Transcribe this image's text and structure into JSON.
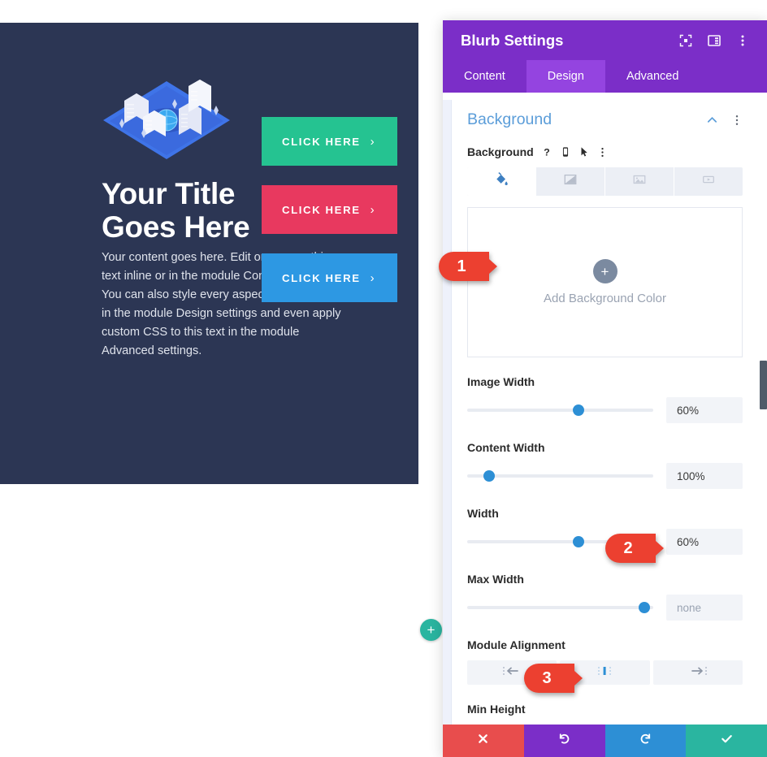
{
  "preview": {
    "hero": {
      "title": "Your Title\nGoes Here",
      "title_line1": "Your Title",
      "title_line2": "Goes Here",
      "body": "Your content goes here. Edit or remove this text inline or in the module Content settings. You can also style every aspect of this content in the module Design settings and even apply custom CSS to this text in the module Advanced settings.",
      "background_color": "#2c3654",
      "illustration": "isometric-city-illustration"
    },
    "buttons": [
      {
        "label": "CLICK HERE",
        "chevron": "›",
        "color": "#25c391",
        "name": "cta-button-green"
      },
      {
        "label": "CLICK HERE",
        "chevron": "›",
        "color": "#e8395f",
        "name": "cta-button-pink"
      },
      {
        "label": "CLICK HERE",
        "chevron": "›",
        "color": "#2d98e3",
        "name": "cta-button-blue"
      }
    ],
    "add_module": {
      "glyph": "+",
      "color": "#2ab5a0",
      "icon": "plus-icon"
    }
  },
  "panel": {
    "title": "Blurb Settings",
    "header_color": "#7b2ec8",
    "header_icons": [
      "fullscreen-icon",
      "layout-panel-icon",
      "more-vertical-icon"
    ],
    "tabs": [
      {
        "label": "Content",
        "active": false
      },
      {
        "label": "Design",
        "active": true
      },
      {
        "label": "Advanced",
        "active": false
      }
    ],
    "active_tab_color": "#9444e0",
    "section": {
      "title": "Background",
      "collapse_icon": "chevron-up-icon",
      "more_icon": "more-vertical-icon"
    },
    "background_field": {
      "label": "Background",
      "icons": [
        "help-icon",
        "mobile-icon",
        "cursor-hover-icon",
        "more-vertical-icon"
      ],
      "types": [
        {
          "name": "background-color-tab",
          "icon": "paint-bucket-icon",
          "active": true
        },
        {
          "name": "background-gradient-tab",
          "icon": "gradient-icon",
          "active": false
        },
        {
          "name": "background-image-tab",
          "icon": "image-icon",
          "active": false
        },
        {
          "name": "background-video-tab",
          "icon": "video-icon",
          "active": false
        }
      ],
      "dropzone": {
        "plus": "+",
        "label": "Add Background Color"
      }
    },
    "sliders": [
      {
        "name": "image-width",
        "label": "Image Width",
        "value": "60%",
        "percent": 60,
        "placeholder": false
      },
      {
        "name": "content-width",
        "label": "Content Width",
        "value": "100%",
        "percent": 12,
        "placeholder": false
      },
      {
        "name": "width",
        "label": "Width",
        "value": "60%",
        "percent": 60,
        "placeholder": false
      },
      {
        "name": "max-width",
        "label": "Max Width",
        "value": "none",
        "percent": 93,
        "placeholder": true
      }
    ],
    "module_alignment": {
      "label": "Module Alignment",
      "options": [
        {
          "name": "align-left",
          "icon": "align-left-icon",
          "active": false
        },
        {
          "name": "align-center",
          "icon": "align-center-icon",
          "active": true
        },
        {
          "name": "align-right",
          "icon": "align-right-icon",
          "active": false
        }
      ]
    },
    "min_height": {
      "label": "Min Height"
    },
    "actions": [
      {
        "name": "cancel-button",
        "icon": "close-icon",
        "color": "#e84d4d"
      },
      {
        "name": "undo-button",
        "icon": "undo-icon",
        "color": "#7b2ec8"
      },
      {
        "name": "redo-button",
        "icon": "redo-icon",
        "color": "#2d8fd5"
      },
      {
        "name": "save-button",
        "icon": "check-icon",
        "color": "#2ab5a0"
      }
    ]
  },
  "step_badges": [
    {
      "number": "1",
      "color": "#ec4030"
    },
    {
      "number": "2",
      "color": "#ec4030"
    },
    {
      "number": "3",
      "color": "#ec4030"
    }
  ]
}
